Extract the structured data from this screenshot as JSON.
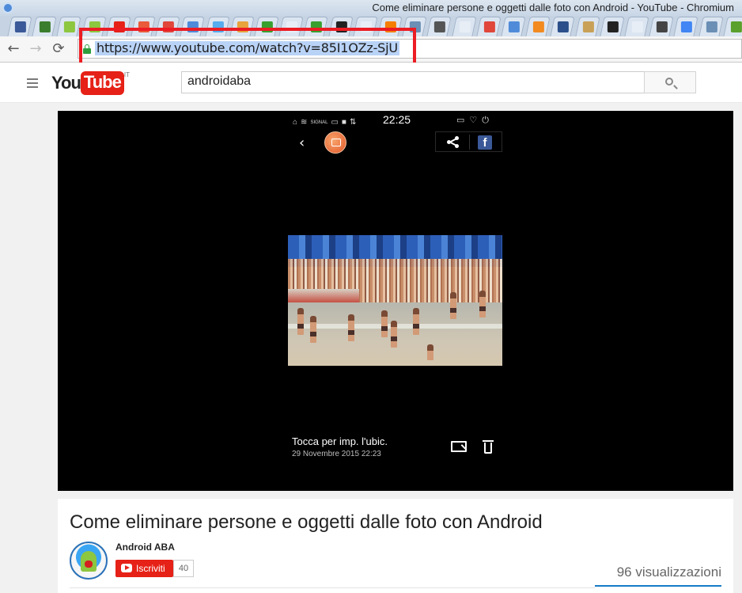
{
  "window": {
    "title": "Come eliminare persone e oggetti dalle foto con Android - YouTube - Chromium"
  },
  "tabs": [
    {
      "icon": "facebook-icon",
      "color": "#3b5998"
    },
    {
      "icon": "chip-icon",
      "color": "#3a7d2c"
    },
    {
      "icon": "android-icon",
      "color": "#8dc63f"
    },
    {
      "icon": "android-icon",
      "color": "#8dc63f"
    },
    {
      "icon": "youtube-icon",
      "color": "#e62117"
    },
    {
      "icon": "calendar-icon",
      "color": "#e95b3a"
    },
    {
      "icon": "triangle-icon",
      "color": "#e0463a"
    },
    {
      "icon": "play-icon",
      "color": "#4f8bd9"
    },
    {
      "icon": "twitter-icon",
      "color": "#55acee"
    },
    {
      "icon": "wrench-icon",
      "color": "#e8a33c"
    },
    {
      "icon": "green-circle-icon",
      "color": "#38a02f"
    },
    {
      "icon": "document-icon",
      "color": "#e8eef6"
    },
    {
      "icon": "green-circle-icon",
      "color": "#38a02f"
    },
    {
      "icon": "film-icon",
      "color": "#222222"
    },
    {
      "icon": "document-icon",
      "color": "#e8eef6"
    },
    {
      "icon": "blogger-icon",
      "color": "#f57d00"
    },
    {
      "icon": "tools-icon",
      "color": "#6b8fb5"
    },
    {
      "icon": "android-icon",
      "color": "#555555"
    },
    {
      "icon": "document-icon",
      "color": "#e8eef6"
    },
    {
      "icon": "play-circle-icon",
      "color": "#e0463a"
    },
    {
      "icon": "translate-icon",
      "color": "#4f8bd9"
    },
    {
      "icon": "download-icon",
      "color": "#f28a20"
    },
    {
      "icon": "mail-icon",
      "color": "#2a4f8a"
    },
    {
      "icon": "badge-icon",
      "color": "#c9a057"
    },
    {
      "icon": "film-icon",
      "color": "#222222"
    },
    {
      "icon": "document-icon",
      "color": "#e8eef6"
    },
    {
      "icon": "steam-icon",
      "color": "#444444"
    },
    {
      "icon": "google-icon",
      "color": "#4285f4"
    },
    {
      "icon": "window-icon",
      "color": "#6b8fb5"
    },
    {
      "icon": "leaf-icon",
      "color": "#5aa02c"
    }
  ],
  "toolbar": {
    "url": "https://www.youtube.com/watch?v=85I1OZz-SjU",
    "back_glyph": "←",
    "forward_glyph": "→",
    "reload_glyph": "⟳"
  },
  "youtube": {
    "logo_you": "You",
    "logo_tube": "Tube",
    "logo_region": "IT",
    "search_value": "androidaba"
  },
  "phone": {
    "status_left": [
      "⌂",
      "≋",
      "SIGNAL",
      "▭",
      "■",
      "⇅"
    ],
    "time": "22:25",
    "status_right": [
      "▭",
      "♡",
      "⏻"
    ],
    "back_glyph": "‹",
    "caption": "Tocca per imp. l'ubic.",
    "date": "29 Novembre 2015 22:23",
    "facebook_glyph": "f"
  },
  "video": {
    "title": "Come eliminare persone e oggetti dalle foto con Android",
    "channel": "Android ABA",
    "subscribe_label": "Iscriviti",
    "subscriber_count": "40",
    "views": "96 visualizzazioni"
  },
  "colors": {
    "highlight_box": "#ec1c24",
    "youtube_red": "#e62117",
    "link_blue": "#167ac6"
  }
}
